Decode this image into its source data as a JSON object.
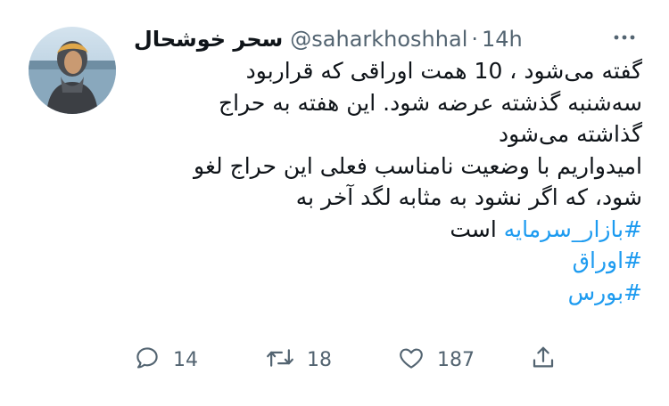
{
  "tweet": {
    "author_name": "سحر خوشحال",
    "handle": "@saharkhoshhal",
    "separator": "·",
    "time": "14h",
    "text_lines": [
      "گفته می‌شود ، 10 همت اوراقی که قراربود",
      "سه‌شنبه گذشته عرضه شود. این هفته به حراج",
      "گذاشته می‌شود",
      "امیدواریم با وضعیت نامناسب فعلی این حراج لغو",
      "شود، که اگر نشود به مثابه لگد آخر به"
    ],
    "hashtag_line": {
      "hashtag": "#بازار_سرمایه",
      "suffix": " است"
    },
    "hashtags": [
      "#اوراق",
      "#بورس"
    ],
    "actions": {
      "reply_count": "14",
      "retweet_count": "18",
      "like_count": "187"
    },
    "icons": {
      "more": "more-horizontal-icon",
      "reply": "reply-icon",
      "retweet": "retweet-icon",
      "like": "heart-icon",
      "share": "share-icon"
    },
    "colors": {
      "hashtag": "#1d9bf0",
      "secondary_text": "#536471",
      "primary_text": "#0f1419"
    }
  }
}
